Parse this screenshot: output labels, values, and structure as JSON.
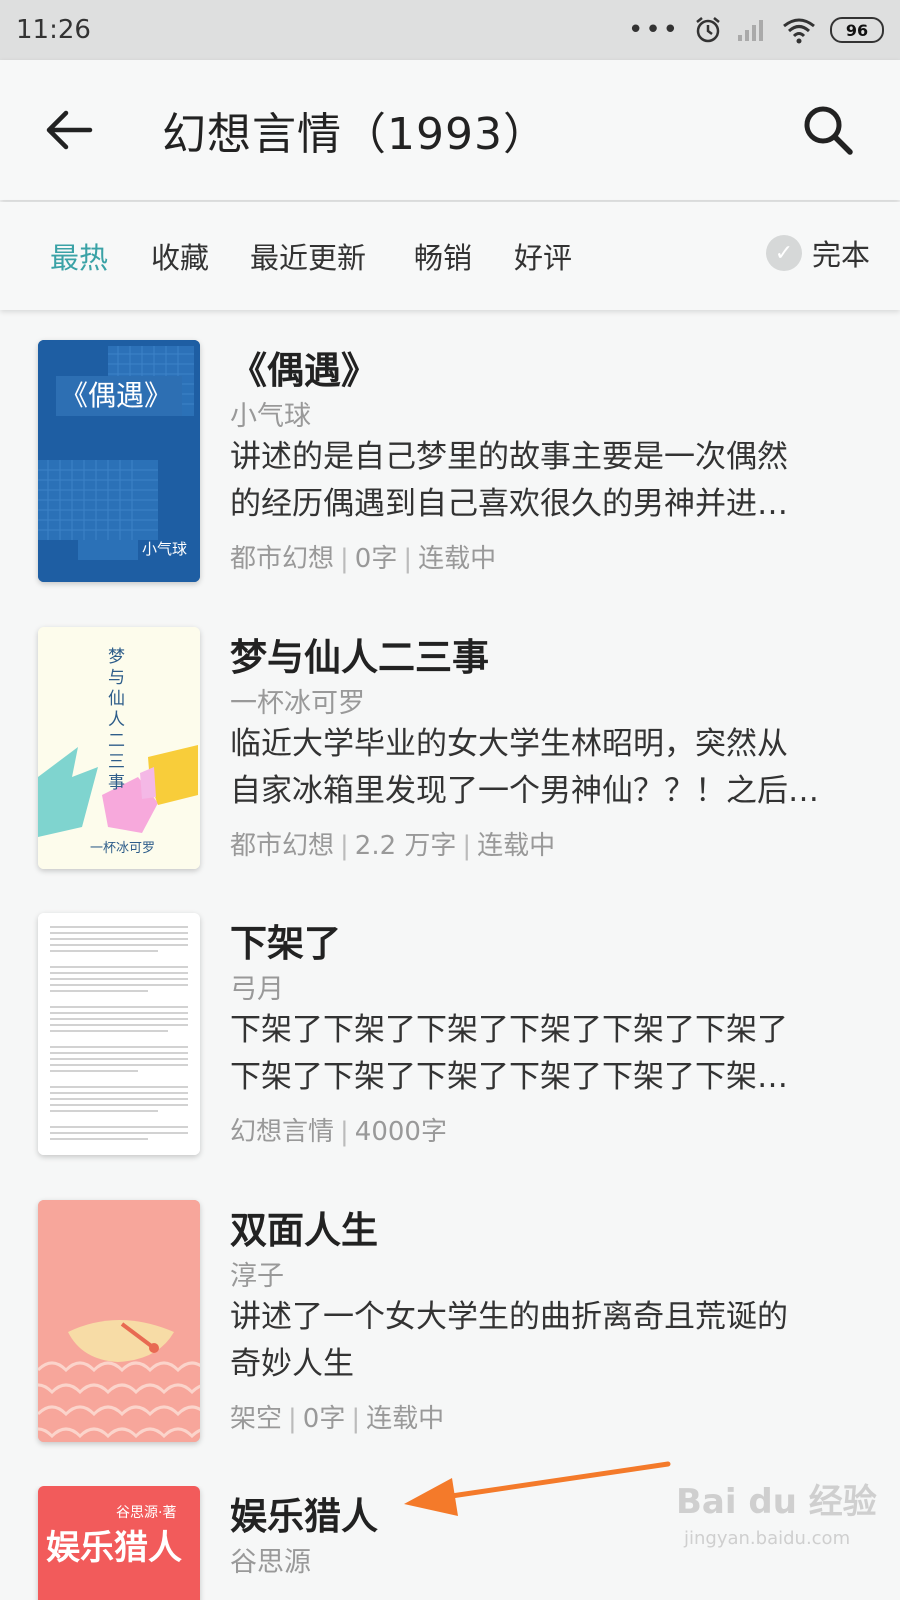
{
  "status_bar": {
    "time": "11:26",
    "dots": "•••",
    "battery": "96"
  },
  "header": {
    "title": "幻想言情（1993）"
  },
  "filters": {
    "tabs": [
      {
        "label": "最热",
        "active": true
      },
      {
        "label": "收藏",
        "active": false
      },
      {
        "label": "最近更新",
        "active": false
      },
      {
        "label": "畅销",
        "active": false
      },
      {
        "label": "好评",
        "active": false
      }
    ],
    "complete_label": "完本"
  },
  "books": [
    {
      "title": "《偶遇》",
      "author": "小气球",
      "desc_lines": [
        "讲述的是自己梦里的故事主要是一次偶然",
        "的经历偶遇到自己喜欢很久的男神并进…"
      ],
      "meta": [
        "都市幻想",
        "0字",
        "连载中"
      ],
      "cover_title": "《偶遇》",
      "cover_author": "小气球"
    },
    {
      "title": "梦与仙人二三事",
      "author": "一杯冰可罗",
      "desc_lines": [
        "临近大学毕业的女大学生林昭明，突然从",
        "自家冰箱里发现了一个男神仙？？！之后…"
      ],
      "meta": [
        "都市幻想",
        "2.2 万字",
        "连载中"
      ],
      "cover_title": "梦与仙人二三事",
      "cover_author": "一杯冰可罗"
    },
    {
      "title": "下架了",
      "author": "弓月",
      "desc_lines": [
        "下架了下架了下架了下架了下架了下架了",
        "下架了下架了下架了下架了下架了下架…"
      ],
      "meta": [
        "幻想言情",
        "4000字"
      ]
    },
    {
      "title": "双面人生",
      "author": "淳子",
      "desc_lines": [
        "讲述了一个女大学生的曲折离奇且荒诞的",
        "奇妙人生"
      ],
      "meta": [
        "架空",
        "0字",
        "连载中"
      ]
    },
    {
      "title": "娱乐猎人",
      "author": "谷思源",
      "cover_title": "娱乐猎人",
      "cover_author": "谷思源·著"
    }
  ],
  "watermark": {
    "text": "Bai du 经验",
    "sub": "jingyan.baidu.com"
  },
  "colors": {
    "accent": "#3aa2a6",
    "arrow": "#f47a2a"
  }
}
